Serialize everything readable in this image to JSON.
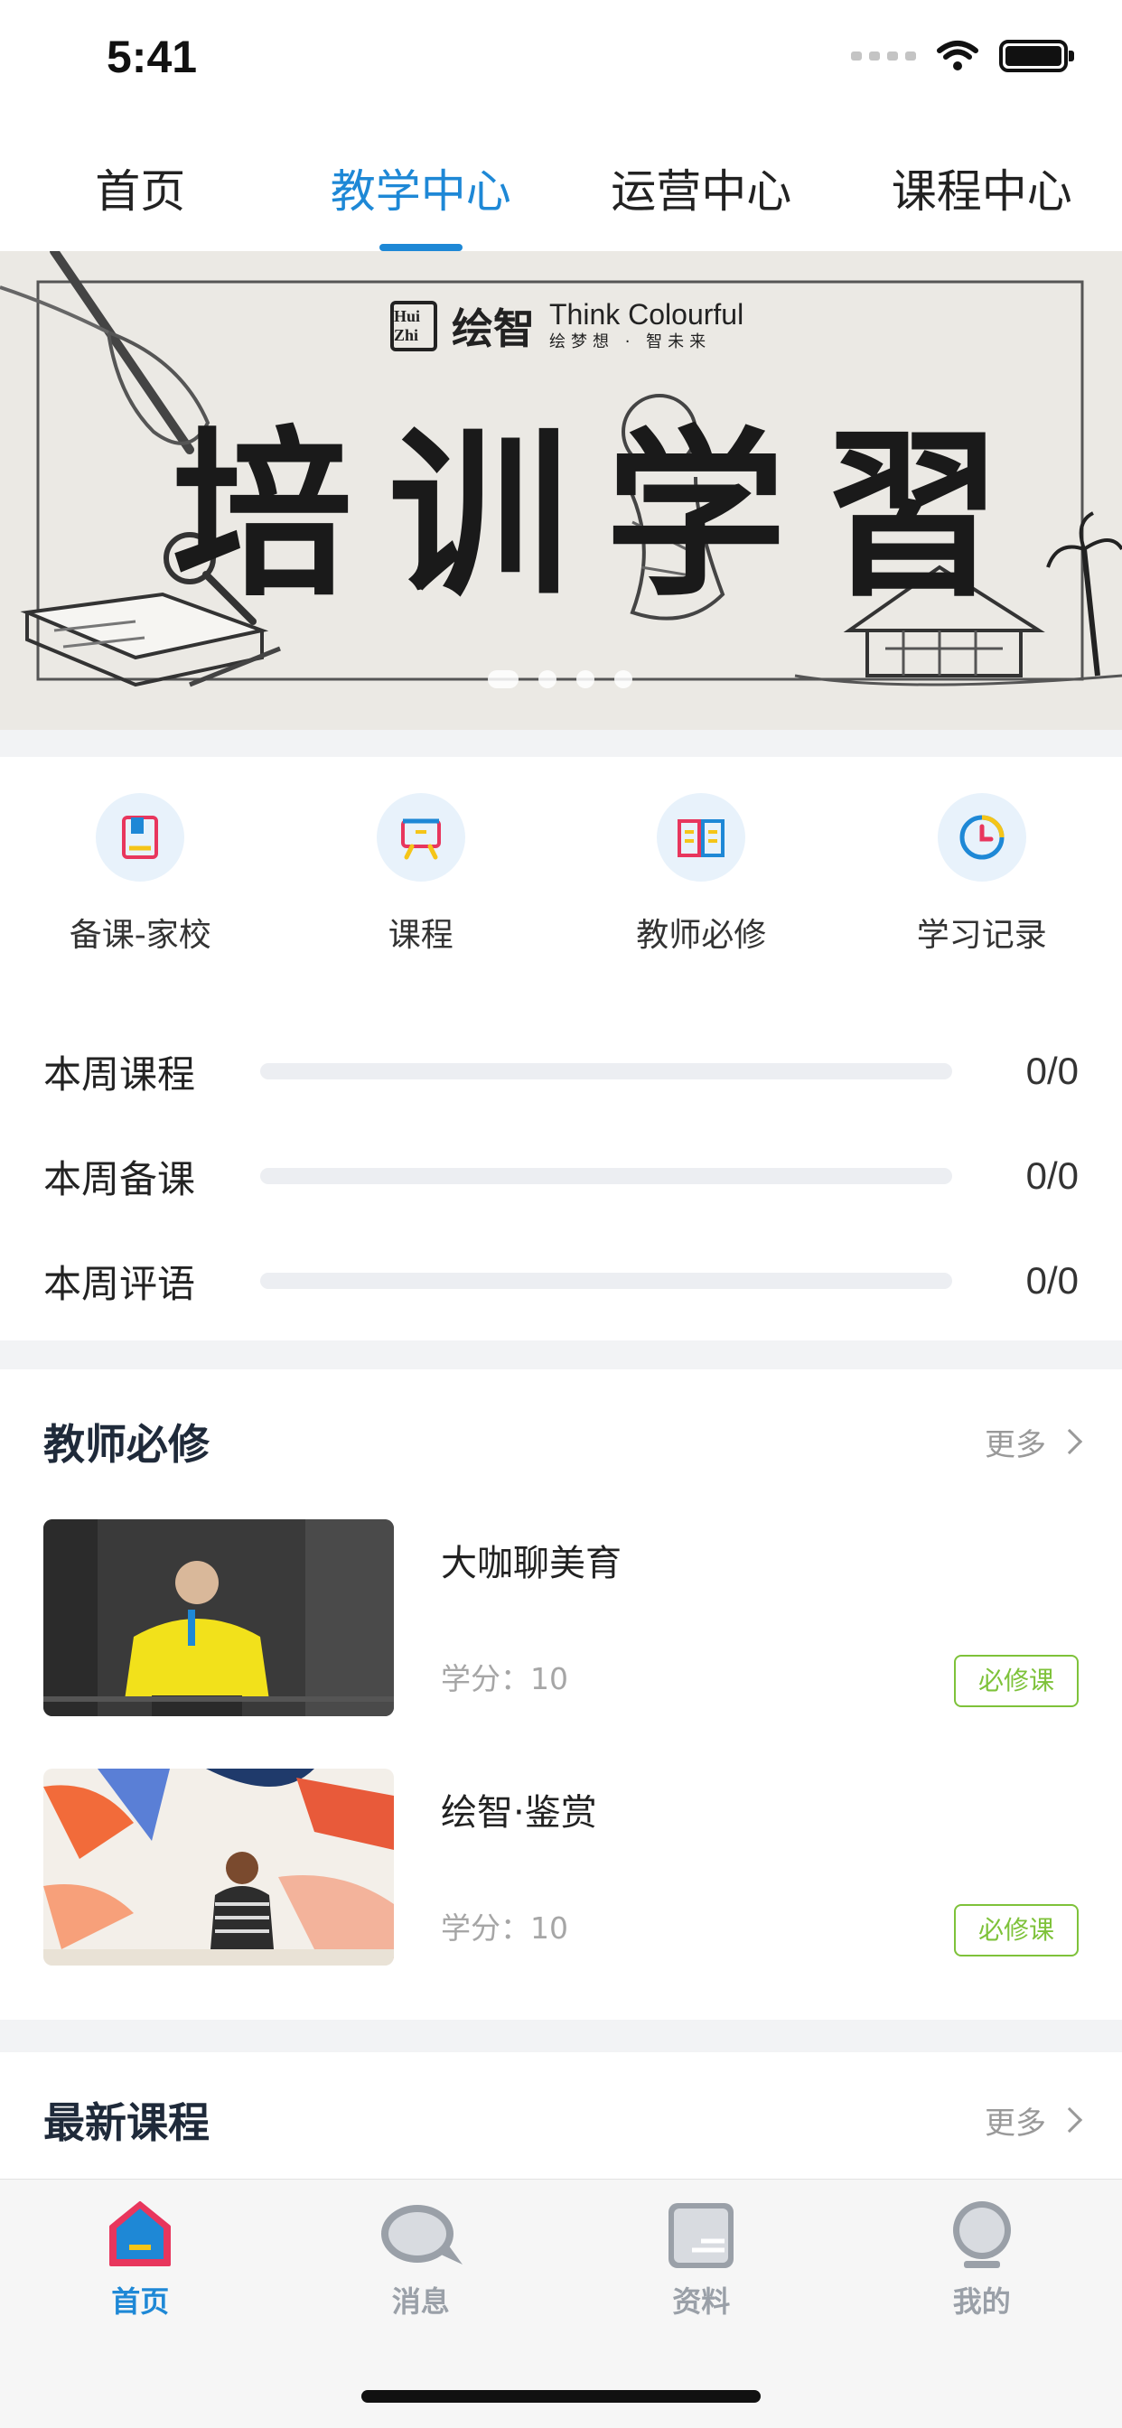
{
  "status_bar": {
    "time": "5:41"
  },
  "top_tabs": [
    {
      "label": "首页",
      "active": false
    },
    {
      "label": "教学中心",
      "active": true
    },
    {
      "label": "运营中心",
      "active": false
    },
    {
      "label": "课程中心",
      "active": false
    }
  ],
  "banner": {
    "brand_cn": "绘智",
    "brand_en": "Think Colourful",
    "brand_slogan": "绘梦想 · 智未来",
    "logo_text": "Hui Zhi",
    "title": "培训学習",
    "pages": 4,
    "current_page": 1
  },
  "quick_access": [
    {
      "label": "备课-家校",
      "icon": "book-icon"
    },
    {
      "label": "课程",
      "icon": "easel-icon"
    },
    {
      "label": "教师必修",
      "icon": "open-book-icon"
    },
    {
      "label": "学习记录",
      "icon": "clock-icon"
    }
  ],
  "weekly_progress": [
    {
      "label": "本周课程",
      "value": "0/0",
      "fraction": 0
    },
    {
      "label": "本周备课",
      "value": "0/0",
      "fraction": 0
    },
    {
      "label": "本周评语",
      "value": "0/0",
      "fraction": 0
    }
  ],
  "teacher_required": {
    "title": "教师必修",
    "more": "更多",
    "courses": [
      {
        "title": "大咖聊美育",
        "credit": "学分：10",
        "badge": "必修课"
      },
      {
        "title": "绘智·鉴赏",
        "credit": "学分：10",
        "badge": "必修课"
      }
    ]
  },
  "latest_courses": {
    "title": "最新课程",
    "more": "更多"
  },
  "bottom_nav": [
    {
      "label": "首页",
      "icon": "home-icon",
      "active": true
    },
    {
      "label": "消息",
      "icon": "chat-bubble-icon",
      "active": false
    },
    {
      "label": "资料",
      "icon": "document-icon",
      "active": false
    },
    {
      "label": "我的",
      "icon": "profile-icon",
      "active": false
    }
  ],
  "colors": {
    "accent": "#1e88d6",
    "badge": "#7ec23a",
    "home_accent_red": "#e8365d"
  }
}
